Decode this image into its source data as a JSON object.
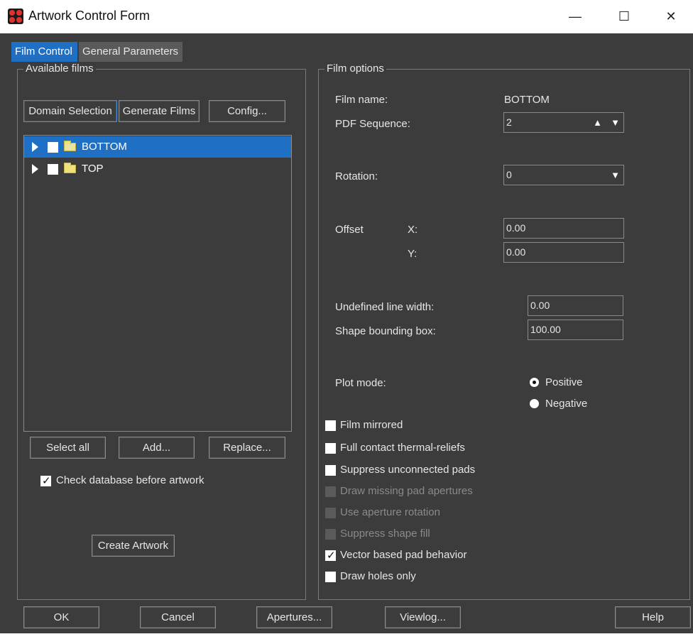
{
  "window": {
    "title": "Artwork Control Form",
    "minimize_glyph": "—",
    "maximize_glyph": "☐",
    "close_glyph": "✕"
  },
  "tabs": [
    {
      "label": "Film Control",
      "active": true
    },
    {
      "label": "General Parameters",
      "active": false
    }
  ],
  "left": {
    "group_title": "Available films",
    "domain_button": "Domain Selection",
    "generate_button": "Generate Films",
    "config_button": "Config...",
    "films": [
      {
        "name": "BOTTOM",
        "selected": true,
        "checked": false
      },
      {
        "name": "TOP",
        "selected": false,
        "checked": false
      }
    ],
    "select_all_button": "Select all",
    "add_button": "Add...",
    "replace_button": "Replace...",
    "check_db_label": "Check database before artwork",
    "check_db_checked": true,
    "create_artwork_button": "Create Artwork"
  },
  "right": {
    "group_title": "Film options",
    "film_name_label": "Film name:",
    "film_name_value": "BOTTOM",
    "pdf_sequence_label": "PDF Sequence:",
    "pdf_sequence_value": "2",
    "rotation_label": "Rotation:",
    "rotation_value": "0",
    "offset_label": "Offset",
    "offset_x_label": "X:",
    "offset_x_value": "0.00",
    "offset_y_label": "Y:",
    "offset_y_value": "0.00",
    "undefined_line_width_label": "Undefined line width:",
    "undefined_line_width_value": "0.00",
    "shape_bounding_box_label": "Shape bounding box:",
    "shape_bounding_box_value": "100.00",
    "plot_mode_label": "Plot mode:",
    "plot_mode_options": [
      "Positive",
      "Negative"
    ],
    "plot_mode_selected": "Positive",
    "options": [
      {
        "label": "Film mirrored",
        "checked": false,
        "enabled": true
      },
      {
        "label": "Full contact thermal-reliefs",
        "checked": false,
        "enabled": true
      },
      {
        "label": "Suppress unconnected pads",
        "checked": false,
        "enabled": true
      },
      {
        "label": "Draw missing pad apertures",
        "checked": false,
        "enabled": false
      },
      {
        "label": "Use aperture rotation",
        "checked": false,
        "enabled": false
      },
      {
        "label": "Suppress shape fill",
        "checked": false,
        "enabled": false
      },
      {
        "label": "Vector based pad behavior",
        "checked": true,
        "enabled": true
      },
      {
        "label": "Draw holes only",
        "checked": false,
        "enabled": true
      }
    ]
  },
  "footer": {
    "ok": "OK",
    "cancel": "Cancel",
    "apertures": "Apertures...",
    "viewlog": "Viewlog...",
    "help": "Help"
  },
  "colors": {
    "background": "#3c3c3c",
    "accent": "#1f6fc5",
    "border": "#8a8a8a"
  }
}
